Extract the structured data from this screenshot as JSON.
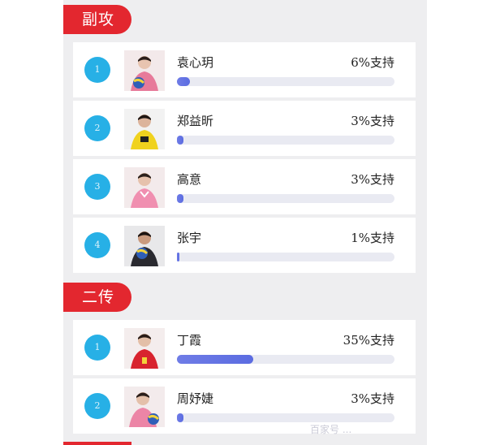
{
  "sections": [
    {
      "title": "副攻",
      "players": [
        {
          "rank": "1",
          "name": "袁心玥",
          "support_label": "6%支持",
          "support_fraction": 0.06
        },
        {
          "rank": "2",
          "name": "郑益昕",
          "support_label": "3%支持",
          "support_fraction": 0.03
        },
        {
          "rank": "3",
          "name": "高意",
          "support_label": "3%支持",
          "support_fraction": 0.03
        },
        {
          "rank": "4",
          "name": "张宇",
          "support_label": "1%支持",
          "support_fraction": 0.01
        }
      ]
    },
    {
      "title": "二传",
      "players": [
        {
          "rank": "1",
          "name": "丁霞",
          "support_label": "35%支持",
          "support_fraction": 0.35
        },
        {
          "rank": "2",
          "name": "周妤婕",
          "support_label": "3%支持",
          "support_fraction": 0.03
        }
      ]
    }
  ],
  "colors": {
    "tab_red": "#e3272f",
    "rank_blue": "#27b0e6",
    "bar_fill": "#5b6ce1",
    "bar_track": "#e9eaf2"
  },
  "watermark": "百家号 ..."
}
